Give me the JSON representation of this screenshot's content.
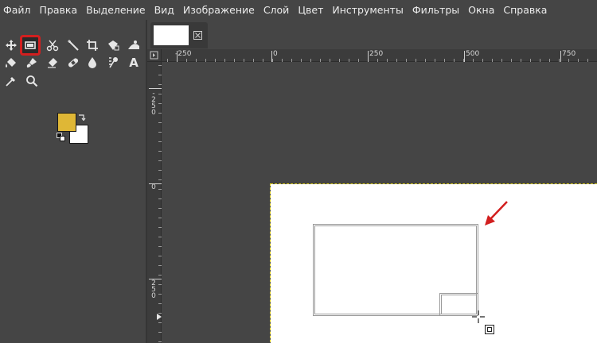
{
  "menubar": {
    "items": [
      "Файл",
      "Правка",
      "Выделение",
      "Вид",
      "Изображение",
      "Слой",
      "Цвет",
      "Инструменты",
      "Фильтры",
      "Окна",
      "Справка"
    ]
  },
  "toolbox": {
    "tools": [
      {
        "name": "move-tool",
        "icon": "move-icon"
      },
      {
        "name": "rect-select-tool",
        "icon": "rect-select-icon",
        "selected": true
      },
      {
        "name": "scissors-select-tool",
        "icon": "scissors-icon"
      },
      {
        "name": "fuzzy-select-tool",
        "icon": "magic-wand-icon"
      },
      {
        "name": "crop-tool",
        "icon": "crop-icon"
      },
      {
        "name": "unified-transform-tool",
        "icon": "transform-icon"
      },
      {
        "name": "warp-transform-tool",
        "icon": "warp-icon"
      },
      {
        "name": "bucket-fill-tool",
        "icon": "bucket-icon"
      },
      {
        "name": "paintbrush-tool",
        "icon": "brush-icon"
      },
      {
        "name": "eraser-tool",
        "icon": "eraser-icon"
      },
      {
        "name": "heal-tool",
        "icon": "bandage-icon"
      },
      {
        "name": "smudge-tool",
        "icon": "drop-icon"
      },
      {
        "name": "dodge-burn-tool",
        "icon": "dodge-icon"
      },
      {
        "name": "text-tool",
        "icon": "text-icon",
        "glyph": "A"
      },
      {
        "name": "color-picker-tool",
        "icon": "eyedropper-icon"
      },
      {
        "name": "zoom-tool",
        "icon": "magnifier-icon"
      }
    ],
    "fg_color": "#dfb736",
    "bg_color": "#ffffff"
  },
  "rulers": {
    "horizontal": [
      "-250",
      "0",
      "250",
      "500",
      "750"
    ],
    "vertical": [
      [
        "-",
        "2",
        "5",
        "0"
      ],
      [
        "0"
      ],
      [
        "2",
        "5",
        "0"
      ]
    ]
  },
  "colors": {
    "accent_selected": "#d21f1f",
    "annotation_arrow": "#d21f1f",
    "selection_border": "#e0d020"
  }
}
